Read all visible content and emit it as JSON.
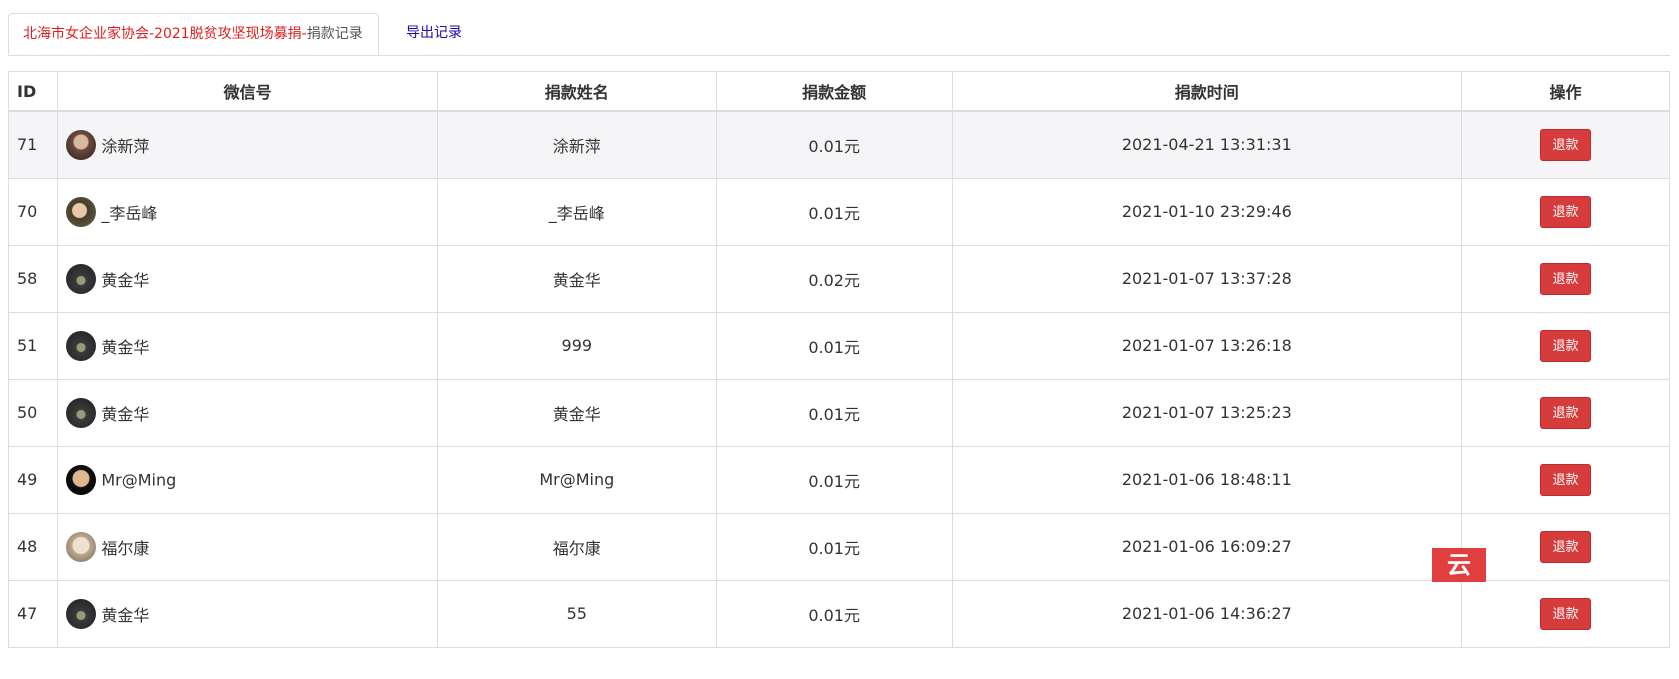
{
  "tabs": {
    "active_title_red": "北海市女企业家协会-2021脱贫攻坚现场募捐-",
    "active_title_suffix": "捐款记录",
    "export_label": "导出记录"
  },
  "table": {
    "headers": {
      "id": "ID",
      "wechat": "微信号",
      "donor_name": "捐款姓名",
      "amount": "捐款金额",
      "time": "捐款时间",
      "action": "操作"
    },
    "rows": [
      {
        "id": "71",
        "wechat": "涂新萍",
        "donor_name": "涂新萍",
        "amount": "0.01元",
        "time": "2021-04-21 13:31:31",
        "action": "退款"
      },
      {
        "id": "70",
        "wechat": "_李岳峰",
        "donor_name": "_李岳峰",
        "amount": "0.01元",
        "time": "2021-01-10 23:29:46",
        "action": "退款"
      },
      {
        "id": "58",
        "wechat": "黄金华",
        "donor_name": "黄金华",
        "amount": "0.02元",
        "time": "2021-01-07 13:37:28",
        "action": "退款"
      },
      {
        "id": "51",
        "wechat": "黄金华",
        "donor_name": "999",
        "amount": "0.01元",
        "time": "2021-01-07 13:26:18",
        "action": "退款"
      },
      {
        "id": "50",
        "wechat": "黄金华",
        "donor_name": "黄金华",
        "amount": "0.01元",
        "time": "2021-01-07 13:25:23",
        "action": "退款"
      },
      {
        "id": "49",
        "wechat": "Mr@Ming",
        "donor_name": "Mr@Ming",
        "amount": "0.01元",
        "time": "2021-01-06 18:48:11",
        "action": "退款"
      },
      {
        "id": "48",
        "wechat": "福尔康",
        "donor_name": "福尔康",
        "amount": "0.01元",
        "time": "2021-01-06 16:09:27",
        "action": "退款"
      },
      {
        "id": "47",
        "wechat": "黄金华",
        "donor_name": "55",
        "amount": "0.01元",
        "time": "2021-01-06 14:36:27",
        "action": "退款"
      }
    ]
  },
  "watermark": {
    "text": "云"
  },
  "colors": {
    "refund_button": "#d63c3c",
    "title_red": "#e02020",
    "export_link": "#1a0dab",
    "row_highlight": "#f5f5f7"
  }
}
